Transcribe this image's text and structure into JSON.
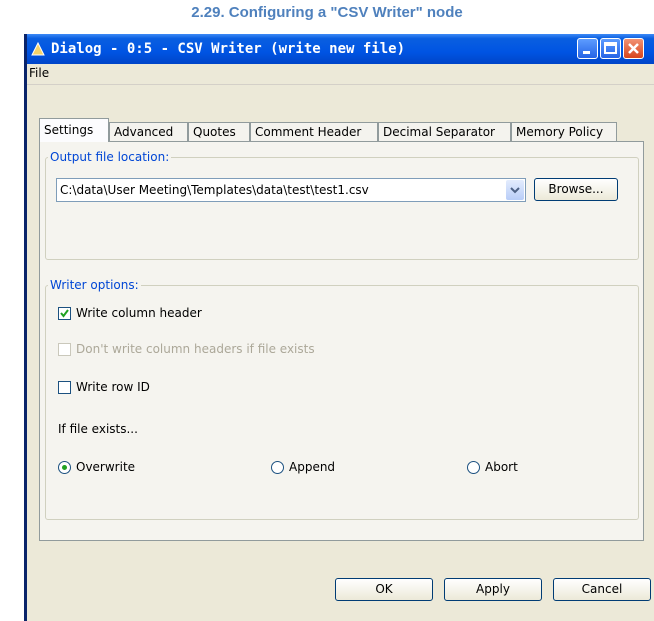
{
  "caption": "2.29. Configuring a \"CSV Writer\" node",
  "window": {
    "title": "Dialog - 0:5 - CSV Writer (write new file)"
  },
  "menu": {
    "file": "File"
  },
  "tabs": [
    {
      "label": "Settings",
      "active": true
    },
    {
      "label": "Advanced",
      "active": false
    },
    {
      "label": "Quotes",
      "active": false
    },
    {
      "label": "Comment Header",
      "active": false
    },
    {
      "label": "Decimal Separator",
      "active": false
    },
    {
      "label": "Memory Policy",
      "active": false
    }
  ],
  "output": {
    "legend": "Output file location:",
    "path": "C:\\data\\User Meeting\\Templates\\data\\test\\test1.csv",
    "browse_label": "Browse..."
  },
  "writer_options": {
    "legend": "Writer options:",
    "write_header": {
      "label": "Write column header",
      "checked": true
    },
    "dont_write_header": {
      "label": "Don't write column headers if file exists",
      "checked": false,
      "disabled": true
    },
    "write_row_id": {
      "label": "Write row ID",
      "checked": false
    },
    "if_exists_label": "If file exists...",
    "radios": [
      {
        "label": "Overwrite",
        "selected": true
      },
      {
        "label": "Append",
        "selected": false
      },
      {
        "label": "Abort",
        "selected": false
      }
    ]
  },
  "buttons": {
    "ok": "OK",
    "apply": "Apply",
    "cancel": "Cancel"
  },
  "colors": {
    "caption": "#4f81bd",
    "titlebar": "#0054e3",
    "legend": "#0046d5",
    "radio_dot": "#21a121"
  }
}
